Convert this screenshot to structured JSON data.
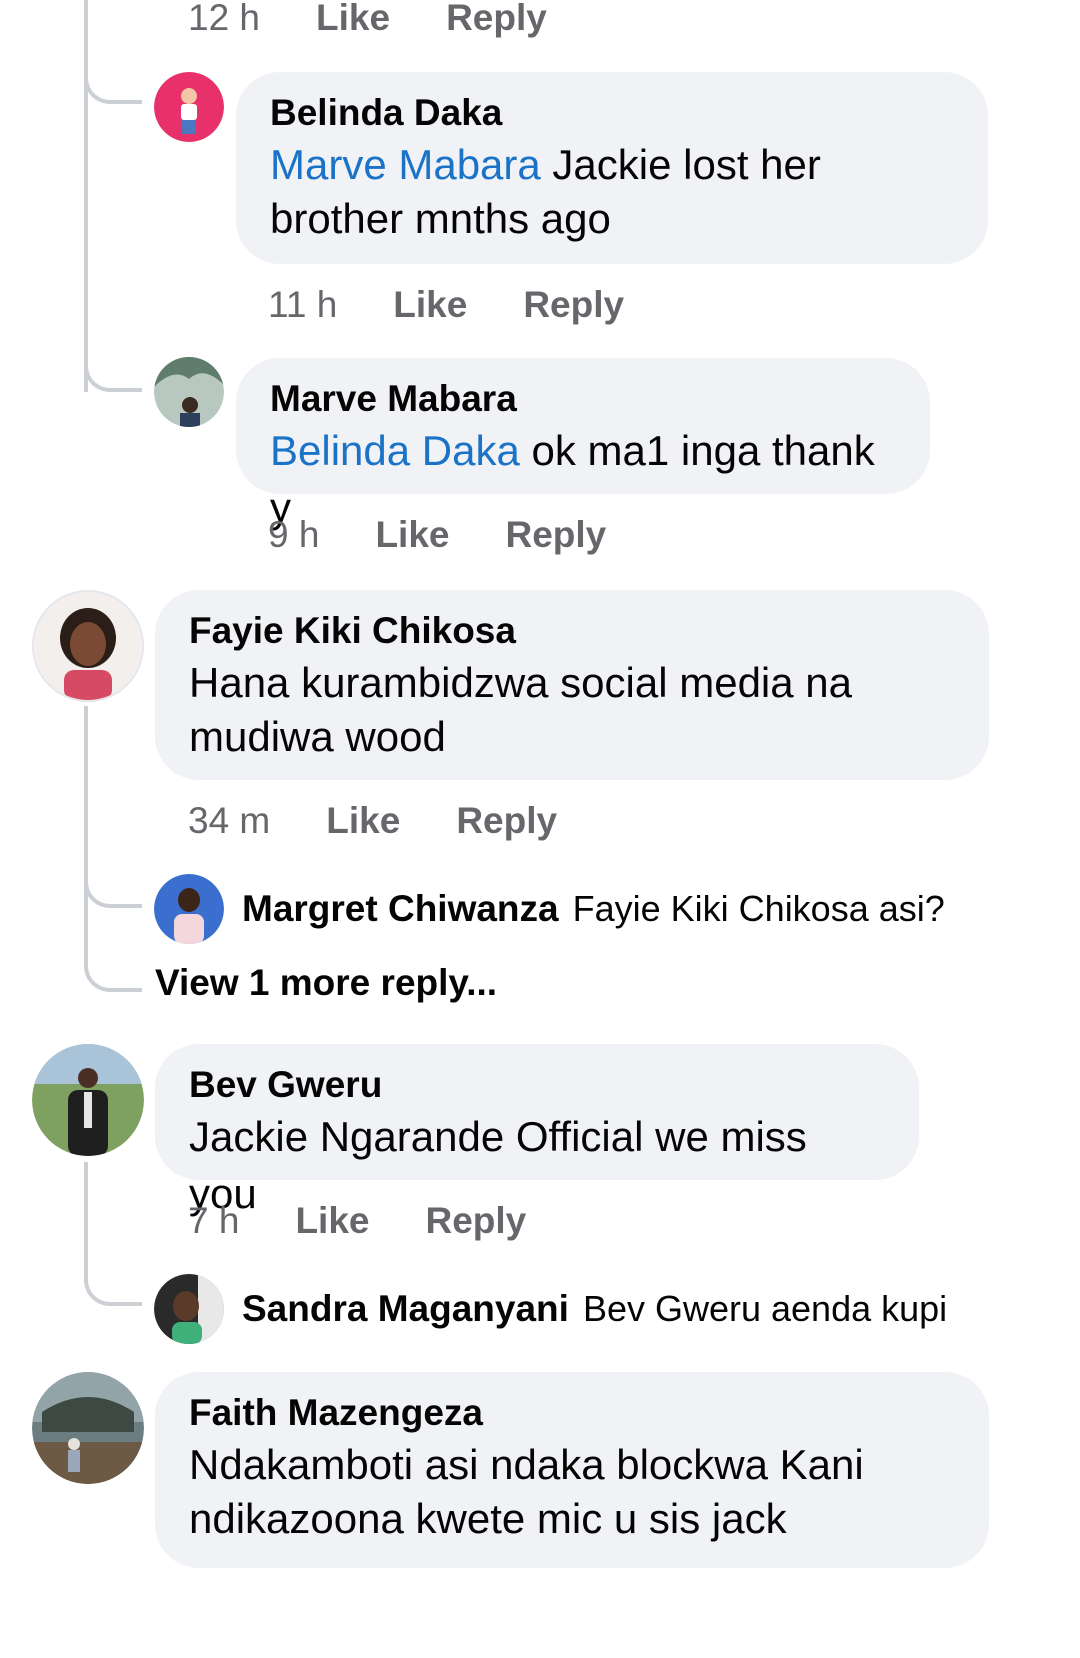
{
  "top_meta": {
    "time": "12 h",
    "like": "Like",
    "reply": "Reply"
  },
  "comments": [
    {
      "author": "Belinda Daka",
      "mention": "Marve Mabara",
      "text_line1": " Jackie lost her",
      "text_line2": "brother  mnths ago",
      "time": "11 h",
      "like": "Like",
      "reply": "Reply",
      "avatar_color": "#e8316b"
    },
    {
      "author": "Marve Mabara",
      "mention": "Belinda Daka",
      "text_line1": " ok ma1 inga thank y",
      "time": "9 h",
      "like": "Like",
      "reply": "Reply",
      "avatar_color": "#7d8f86"
    },
    {
      "author": "Fayie Kiki Chikosa",
      "text_line1": "Hana kurambidzwa social media na",
      "text_line2": "mudiwa wood",
      "time": "34 m",
      "like": "Like",
      "reply": "Reply",
      "avatar_color": "#c9b8b0"
    },
    {
      "author": "Margret Chiwanza",
      "text": "Fayie Kiki Chikosa asi?",
      "avatar_color": "#3a6fd0"
    },
    {
      "view_more": "View 1 more reply..."
    },
    {
      "author": "Bev Gweru",
      "text_line1": "Jackie Ngarande Official we miss you",
      "time": "7 h",
      "like": "Like",
      "reply": "Reply",
      "avatar_color": "#4f7a3a"
    },
    {
      "author": "Sandra Maganyani",
      "text": "Bev Gweru aenda kupi",
      "avatar_color": "#2a2a2a"
    },
    {
      "author": "Faith Mazengeza",
      "text_line1": "Ndakamboti asi ndaka blockwa Kani",
      "text_line2": "ndikazoona kwete mic u sis jack",
      "avatar_color": "#5a6e73"
    }
  ]
}
